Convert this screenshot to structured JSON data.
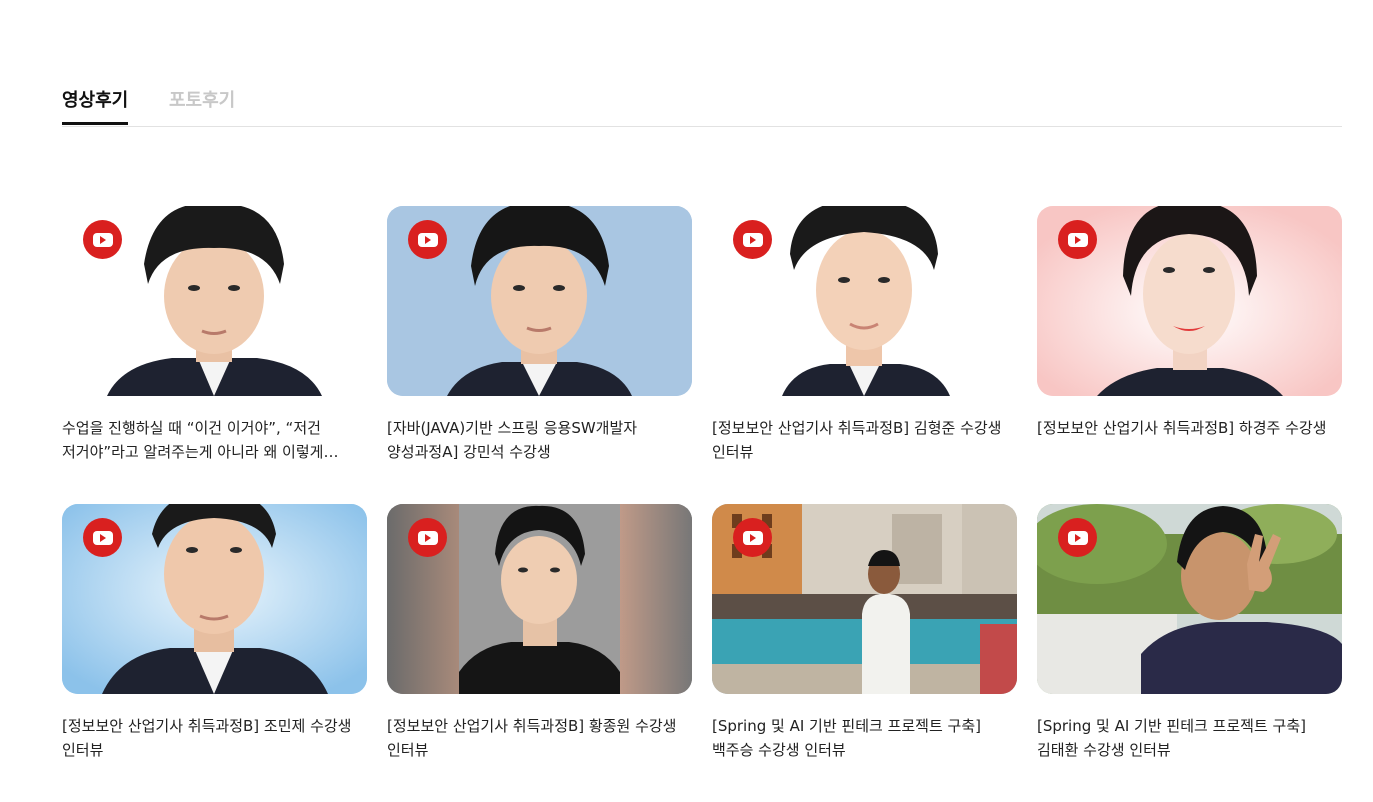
{
  "tabs": [
    {
      "label": "영상후기",
      "active": true
    },
    {
      "label": "포토후기",
      "active": false
    }
  ],
  "accent_color": "#d9201f",
  "cards": [
    {
      "title": "수업을 진행하실 때 “이건 이거야”, “저건 저거야”라고 알려주는게 아니라 왜 이렇게 되는지",
      "icon": "youtube-play-icon"
    },
    {
      "title": "[자바(JAVA)기반 스프링 응용SW개발자 양성과정A] 강민석 수강생",
      "icon": "youtube-play-icon"
    },
    {
      "title": "[정보보안 산업기사 취득과정B] 김형준 수강생 인터뷰",
      "icon": "youtube-play-icon"
    },
    {
      "title": "[정보보안 산업기사 취득과정B] 하경주 수강생",
      "icon": "youtube-play-icon"
    },
    {
      "title": "[정보보안 산업기사 취득과정B] 조민제 수강생 인터뷰",
      "icon": "youtube-play-icon"
    },
    {
      "title": "[정보보안 산업기사 취득과정B] 황종원 수강생 인터뷰",
      "icon": "youtube-play-icon"
    },
    {
      "title": "[Spring 및 AI 기반 핀테크 프로젝트 구축] 백주승 수강생 인터뷰",
      "icon": "youtube-play-icon"
    },
    {
      "title": "[Spring 및 AI 기반 핀테크 프로젝트 구축] 김태환 수강생 인터뷰",
      "icon": "youtube-play-icon"
    }
  ]
}
